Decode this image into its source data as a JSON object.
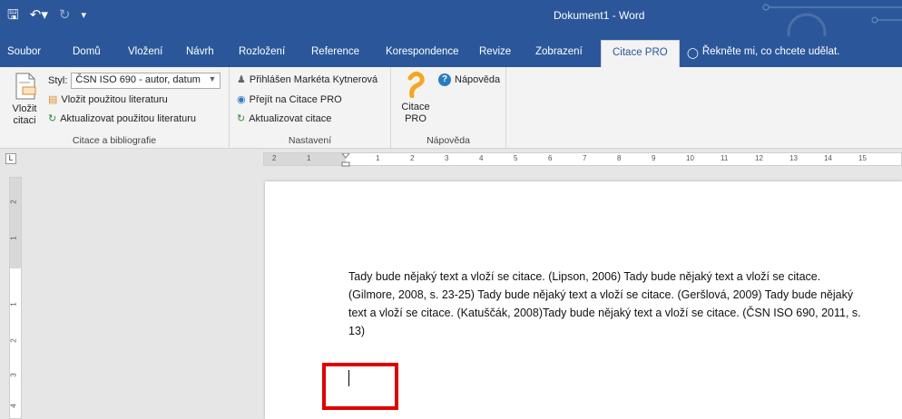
{
  "window": {
    "title": "Dokument1 - Word"
  },
  "tabs": [
    "Soubor",
    "Domů",
    "Vložení",
    "Návrh",
    "Rozložení",
    "Reference",
    "Korespondence",
    "Revize",
    "Zobrazení",
    "Citace PRO"
  ],
  "active_tab": "Citace PRO",
  "tell_me": "Řekněte mi, co chcete udělat.",
  "ribbon": {
    "group1": {
      "insert_citation": "Vložit citaci",
      "styl_label": "Styl:",
      "styl_value": "ČSN ISO 690 - autor, datum",
      "insert_literature": "Vložit použitou literaturu",
      "update_literature": "Aktualizovat použitou literaturu",
      "label": "Citace a bibliografie"
    },
    "group2": {
      "logged_in": "Přihlášen Markéta Kytnerová",
      "go_to": "Přejít na Citace PRO",
      "update_citations": "Aktualizovat citace",
      "label": "Nastavení"
    },
    "group3": {
      "citace_pro": "Citace PRO",
      "help": "Nápověda",
      "label": "Nápověda"
    }
  },
  "ruler": {
    "marks": [
      "2",
      "1",
      "1",
      "2",
      "3",
      "4",
      "5",
      "6",
      "7",
      "8",
      "9",
      "10",
      "11",
      "12",
      "13",
      "14",
      "15"
    ],
    "vmarks": [
      "2",
      "1",
      "1",
      "2",
      "3",
      "4"
    ]
  },
  "document": {
    "line1": "Tady bude nějaký text a vloží se citace. (Lipson, 2006) Tady bude nějaký text a vloží se citace.",
    "line2": "(Gilmore, 2008, s. 23-25) Tady bude nějaký text a vloží se citace. (Geršlová, 2009) Tady bude nějaký",
    "line3": "text a vloží se citace. (Katuščák, 2008)Tady bude nějaký text a vloží se citace. (ČSN ISO 690, 2011, s.",
    "line4": "13)"
  },
  "colors": {
    "accent": "#2b579a",
    "highlight": "#e00000"
  }
}
